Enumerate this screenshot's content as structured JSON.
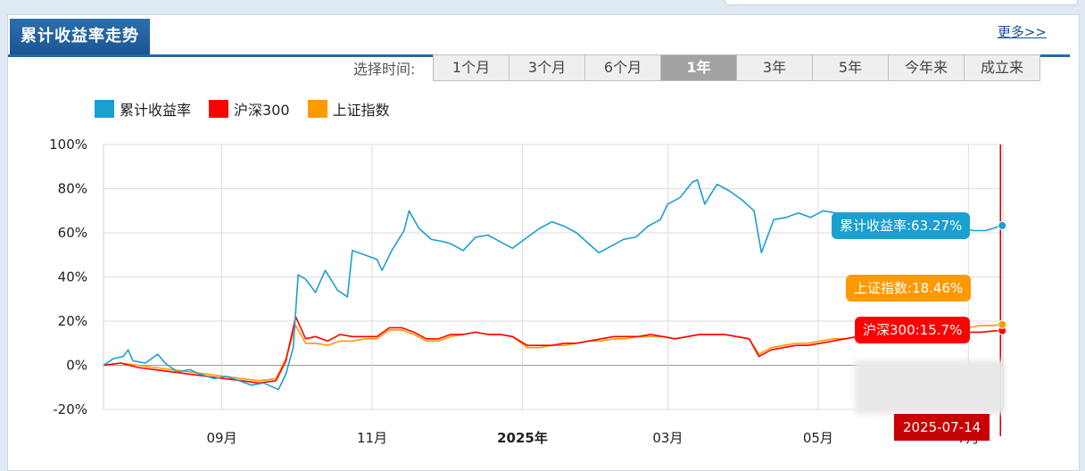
{
  "header": {
    "title": "累计收益率走势",
    "more": "更多>>"
  },
  "range": {
    "label": "选择时间:",
    "options": [
      "1个月",
      "3个月",
      "6个月",
      "1年",
      "3年",
      "5年",
      "今年来",
      "成立来"
    ],
    "selected": "1年"
  },
  "tooltips": {
    "fund": "累计收益率:63.27%",
    "sse": "上证指数:18.46%",
    "hs300": "沪深300:15.7%",
    "date": "2025-07-14"
  },
  "colors": {
    "fund": "#1a9fd0",
    "hs300": "#ff0000",
    "sse": "#ff9900",
    "cursor": "#c80000"
  },
  "chart_data": {
    "type": "line",
    "title": "",
    "xlabel": "",
    "ylabel": "",
    "ylim": [
      -20,
      100
    ],
    "yticks": [
      "100%",
      "80%",
      "60%",
      "40%",
      "20%",
      "0%",
      "-20%"
    ],
    "x_tick_labels": [
      "09月",
      "11月",
      "2025年",
      "03月",
      "05月",
      "7月"
    ],
    "grid": true,
    "legend": "top-left",
    "x_start": "2024-07-15",
    "x_end": "2025-07-15",
    "cursor_date": "2025-07-14",
    "series": [
      {
        "name": "累计收益率",
        "points": [
          [
            "2024-07-15",
            0
          ],
          [
            "2024-07-19",
            3
          ],
          [
            "2024-07-23",
            4
          ],
          [
            "2024-07-25",
            7
          ],
          [
            "2024-07-27",
            2
          ],
          [
            "2024-08-01",
            1
          ],
          [
            "2024-08-06",
            5
          ],
          [
            "2024-08-09",
            1
          ],
          [
            "2024-08-14",
            -3
          ],
          [
            "2024-08-19",
            -2
          ],
          [
            "2024-08-23",
            -4
          ],
          [
            "2024-08-29",
            -6
          ],
          [
            "2024-09-03",
            -5
          ],
          [
            "2024-09-08",
            -7
          ],
          [
            "2024-09-13",
            -9
          ],
          [
            "2024-09-18",
            -8
          ],
          [
            "2024-09-24",
            -11
          ],
          [
            "2024-09-27",
            -4
          ],
          [
            "2024-09-30",
            8
          ],
          [
            "2024-10-02",
            41
          ],
          [
            "2024-10-05",
            39
          ],
          [
            "2024-10-09",
            33
          ],
          [
            "2024-10-13",
            43
          ],
          [
            "2024-10-18",
            34
          ],
          [
            "2024-10-22",
            31
          ],
          [
            "2024-10-24",
            52
          ],
          [
            "2024-10-29",
            50
          ],
          [
            "2024-11-03",
            48
          ],
          [
            "2024-11-05",
            43
          ],
          [
            "2024-11-09",
            52
          ],
          [
            "2024-11-14",
            61
          ],
          [
            "2024-11-16",
            70
          ],
          [
            "2024-11-20",
            62
          ],
          [
            "2024-11-25",
            57
          ],
          [
            "2024-11-30",
            56
          ],
          [
            "2024-12-03",
            55
          ],
          [
            "2024-12-08",
            52
          ],
          [
            "2024-12-13",
            58
          ],
          [
            "2024-12-18",
            59
          ],
          [
            "2024-12-23",
            56
          ],
          [
            "2024-12-28",
            53
          ],
          [
            "2025-01-03",
            58
          ],
          [
            "2025-01-08",
            62
          ],
          [
            "2025-01-13",
            65
          ],
          [
            "2025-01-18",
            63
          ],
          [
            "2025-01-23",
            60
          ],
          [
            "2025-01-28",
            55
          ],
          [
            "2025-02-01",
            51
          ],
          [
            "2025-02-06",
            54
          ],
          [
            "2025-02-11",
            57
          ],
          [
            "2025-02-16",
            58
          ],
          [
            "2025-02-21",
            63
          ],
          [
            "2025-02-26",
            66
          ],
          [
            "2025-03-01",
            73
          ],
          [
            "2025-03-06",
            76
          ],
          [
            "2025-03-11",
            83
          ],
          [
            "2025-03-13",
            84
          ],
          [
            "2025-03-16",
            73
          ],
          [
            "2025-03-21",
            82
          ],
          [
            "2025-03-26",
            79
          ],
          [
            "2025-03-31",
            75
          ],
          [
            "2025-04-05",
            70
          ],
          [
            "2025-04-08",
            51
          ],
          [
            "2025-04-13",
            66
          ],
          [
            "2025-04-18",
            67
          ],
          [
            "2025-04-23",
            69
          ],
          [
            "2025-04-28",
            67
          ],
          [
            "2025-05-03",
            70
          ],
          [
            "2025-05-08",
            69
          ],
          [
            "2025-05-13",
            67
          ],
          [
            "2025-05-18",
            68
          ],
          [
            "2025-05-23",
            66
          ],
          [
            "2025-05-28",
            65
          ],
          [
            "2025-06-03",
            63
          ],
          [
            "2025-06-08",
            64
          ],
          [
            "2025-06-13",
            64
          ],
          [
            "2025-06-18",
            62
          ],
          [
            "2025-06-23",
            64
          ],
          [
            "2025-06-28",
            62
          ],
          [
            "2025-07-03",
            61
          ],
          [
            "2025-07-08",
            61
          ],
          [
            "2025-07-11",
            62
          ],
          [
            "2025-07-14",
            63.27
          ]
        ]
      },
      {
        "name": "沪深300",
        "points": [
          [
            "2024-07-15",
            0
          ],
          [
            "2024-07-22",
            1
          ],
          [
            "2024-07-29",
            -1
          ],
          [
            "2024-08-05",
            -2
          ],
          [
            "2024-08-12",
            -3
          ],
          [
            "2024-08-19",
            -4
          ],
          [
            "2024-08-26",
            -5
          ],
          [
            "2024-09-02",
            -6
          ],
          [
            "2024-09-09",
            -7
          ],
          [
            "2024-09-16",
            -8
          ],
          [
            "2024-09-23",
            -7
          ],
          [
            "2024-09-27",
            2
          ],
          [
            "2024-10-01",
            22
          ],
          [
            "2024-10-05",
            12
          ],
          [
            "2024-10-09",
            13
          ],
          [
            "2024-10-14",
            11
          ],
          [
            "2024-10-19",
            14
          ],
          [
            "2024-10-24",
            13
          ],
          [
            "2024-10-29",
            13
          ],
          [
            "2024-11-03",
            13
          ],
          [
            "2024-11-08",
            17
          ],
          [
            "2024-11-13",
            17
          ],
          [
            "2024-11-18",
            15
          ],
          [
            "2024-11-23",
            12
          ],
          [
            "2024-11-28",
            12
          ],
          [
            "2024-12-03",
            14
          ],
          [
            "2024-12-08",
            14
          ],
          [
            "2024-12-13",
            15
          ],
          [
            "2024-12-18",
            14
          ],
          [
            "2024-12-23",
            14
          ],
          [
            "2024-12-28",
            13
          ],
          [
            "2025-01-03",
            9
          ],
          [
            "2025-01-08",
            9
          ],
          [
            "2025-01-13",
            9
          ],
          [
            "2025-01-18",
            10
          ],
          [
            "2025-01-23",
            10
          ],
          [
            "2025-01-28",
            11
          ],
          [
            "2025-02-02",
            12
          ],
          [
            "2025-02-07",
            13
          ],
          [
            "2025-02-12",
            13
          ],
          [
            "2025-02-17",
            13
          ],
          [
            "2025-02-22",
            14
          ],
          [
            "2025-02-27",
            13
          ],
          [
            "2025-03-04",
            12
          ],
          [
            "2025-03-09",
            13
          ],
          [
            "2025-03-14",
            14
          ],
          [
            "2025-03-19",
            14
          ],
          [
            "2025-03-24",
            14
          ],
          [
            "2025-03-29",
            13
          ],
          [
            "2025-04-03",
            12
          ],
          [
            "2025-04-07",
            4
          ],
          [
            "2025-04-12",
            7
          ],
          [
            "2025-04-17",
            8
          ],
          [
            "2025-04-22",
            9
          ],
          [
            "2025-04-27",
            9
          ],
          [
            "2025-05-02",
            10
          ],
          [
            "2025-05-07",
            11
          ],
          [
            "2025-05-12",
            12
          ],
          [
            "2025-05-17",
            13
          ],
          [
            "2025-05-22",
            13
          ],
          [
            "2025-05-27",
            13
          ],
          [
            "2025-06-01",
            13
          ],
          [
            "2025-06-06",
            14
          ],
          [
            "2025-06-11",
            14
          ],
          [
            "2025-06-16",
            14
          ],
          [
            "2025-06-21",
            14
          ],
          [
            "2025-06-26",
            15
          ],
          [
            "2025-07-01",
            15
          ],
          [
            "2025-07-06",
            15
          ],
          [
            "2025-07-11",
            15.5
          ],
          [
            "2025-07-14",
            15.7
          ]
        ]
      },
      {
        "name": "上证指数",
        "points": [
          [
            "2024-07-15",
            0
          ],
          [
            "2024-07-22",
            1
          ],
          [
            "2024-07-29",
            0
          ],
          [
            "2024-08-05",
            -1
          ],
          [
            "2024-08-12",
            -2
          ],
          [
            "2024-08-19",
            -3
          ],
          [
            "2024-08-26",
            -4
          ],
          [
            "2024-09-02",
            -5
          ],
          [
            "2024-09-09",
            -6
          ],
          [
            "2024-09-16",
            -7
          ],
          [
            "2024-09-23",
            -6
          ],
          [
            "2024-09-27",
            3
          ],
          [
            "2024-10-01",
            18
          ],
          [
            "2024-10-05",
            10
          ],
          [
            "2024-10-09",
            10
          ],
          [
            "2024-10-14",
            9
          ],
          [
            "2024-10-19",
            11
          ],
          [
            "2024-10-24",
            11
          ],
          [
            "2024-10-29",
            12
          ],
          [
            "2024-11-03",
            12
          ],
          [
            "2024-11-08",
            16
          ],
          [
            "2024-11-13",
            16
          ],
          [
            "2024-11-18",
            14
          ],
          [
            "2024-11-23",
            11
          ],
          [
            "2024-11-28",
            11
          ],
          [
            "2024-12-03",
            13
          ],
          [
            "2024-12-08",
            14
          ],
          [
            "2024-12-13",
            15
          ],
          [
            "2024-12-18",
            14
          ],
          [
            "2024-12-23",
            14
          ],
          [
            "2024-12-28",
            13
          ],
          [
            "2025-01-03",
            8
          ],
          [
            "2025-01-08",
            8
          ],
          [
            "2025-01-13",
            9
          ],
          [
            "2025-01-18",
            9
          ],
          [
            "2025-01-23",
            10
          ],
          [
            "2025-01-28",
            11
          ],
          [
            "2025-02-02",
            11
          ],
          [
            "2025-02-07",
            12
          ],
          [
            "2025-02-12",
            12
          ],
          [
            "2025-02-17",
            13
          ],
          [
            "2025-02-22",
            13
          ],
          [
            "2025-02-27",
            13
          ],
          [
            "2025-03-04",
            12
          ],
          [
            "2025-03-09",
            13
          ],
          [
            "2025-03-14",
            14
          ],
          [
            "2025-03-19",
            14
          ],
          [
            "2025-03-24",
            14
          ],
          [
            "2025-03-29",
            13
          ],
          [
            "2025-04-03",
            12
          ],
          [
            "2025-04-07",
            5
          ],
          [
            "2025-04-12",
            8
          ],
          [
            "2025-04-17",
            9
          ],
          [
            "2025-04-22",
            10
          ],
          [
            "2025-04-27",
            10
          ],
          [
            "2025-05-02",
            11
          ],
          [
            "2025-05-07",
            12
          ],
          [
            "2025-05-12",
            12
          ],
          [
            "2025-05-17",
            13
          ],
          [
            "2025-05-22",
            14
          ],
          [
            "2025-05-27",
            14
          ],
          [
            "2025-06-01",
            14
          ],
          [
            "2025-06-06",
            15
          ],
          [
            "2025-06-11",
            15
          ],
          [
            "2025-06-16",
            16
          ],
          [
            "2025-06-21",
            16
          ],
          [
            "2025-06-26",
            17
          ],
          [
            "2025-07-01",
            17
          ],
          [
            "2025-07-06",
            18
          ],
          [
            "2025-07-11",
            18
          ],
          [
            "2025-07-14",
            18.46
          ]
        ]
      }
    ]
  }
}
